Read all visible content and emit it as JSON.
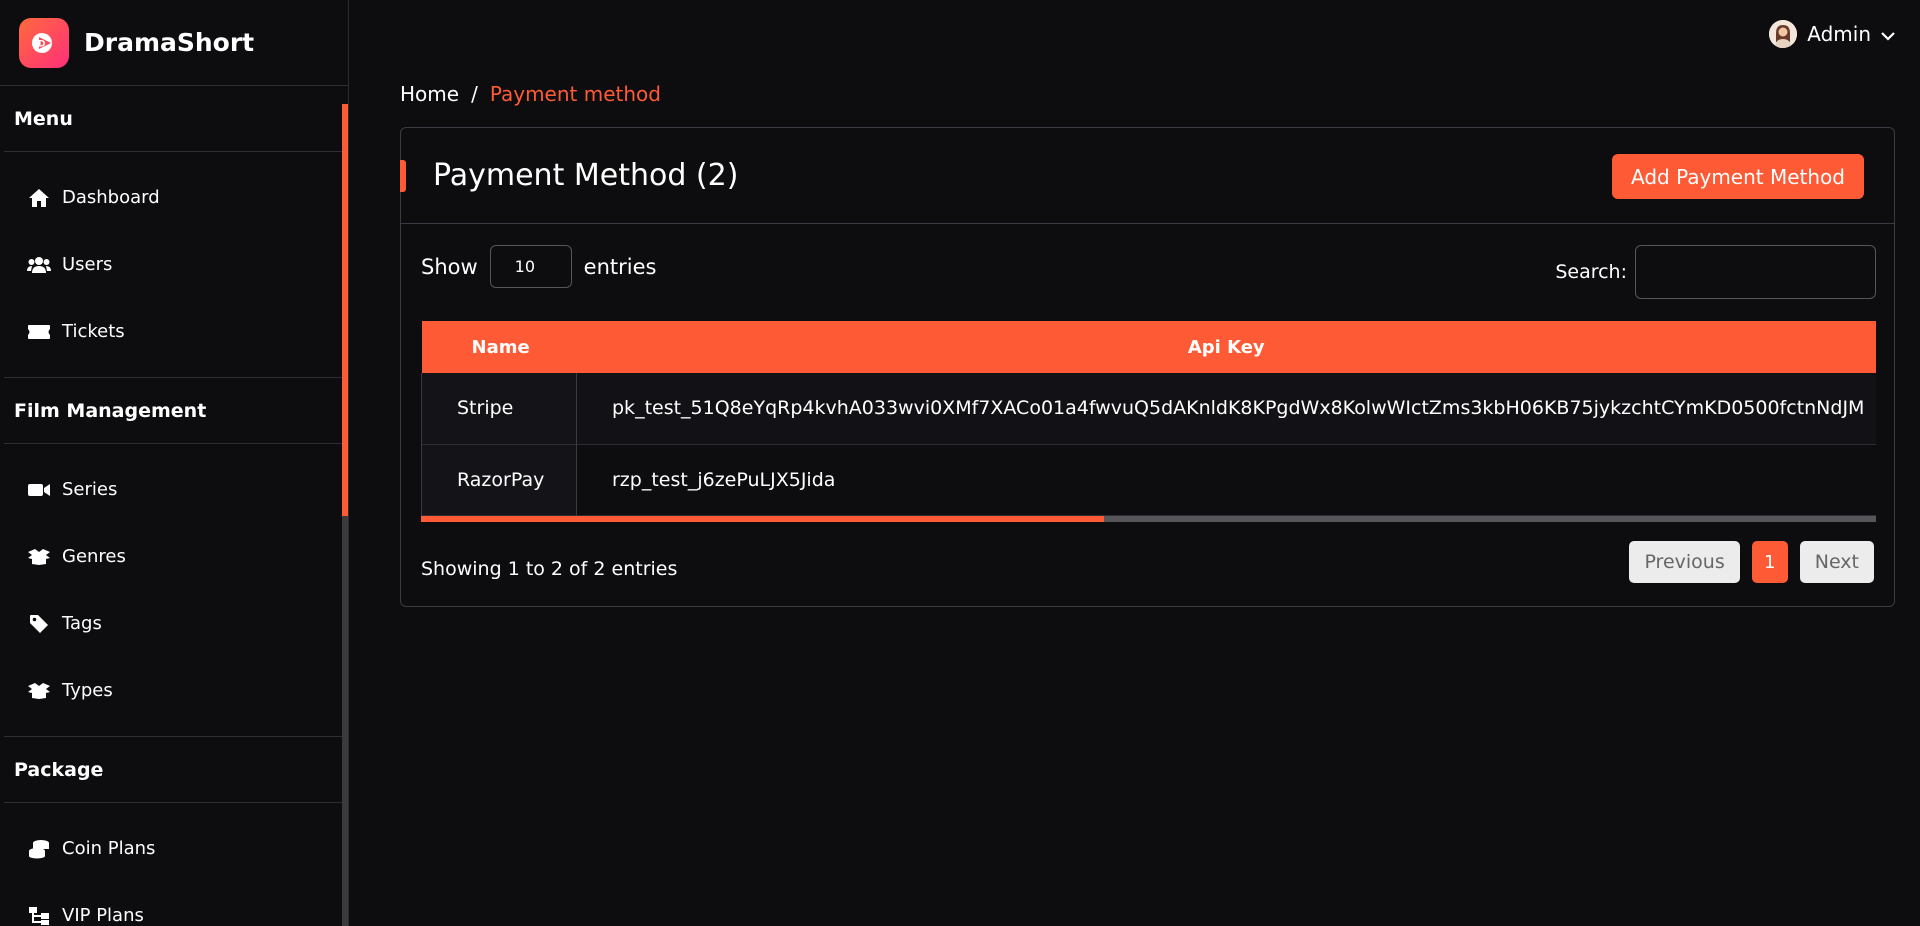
{
  "brand": {
    "name": "DramaShort",
    "logo_icon": "play-icon"
  },
  "user": {
    "name": "Admin"
  },
  "sidebar": {
    "sections": [
      {
        "title": "Menu",
        "items": [
          {
            "label": "Dashboard",
            "icon": "home-icon"
          },
          {
            "label": "Users",
            "icon": "users-icon"
          },
          {
            "label": "Tickets",
            "icon": "ticket-icon"
          }
        ]
      },
      {
        "title": "Film Management",
        "items": [
          {
            "label": "Series",
            "icon": "video-icon"
          },
          {
            "label": "Genres",
            "icon": "box-icon"
          },
          {
            "label": "Tags",
            "icon": "tag-icon"
          },
          {
            "label": "Types",
            "icon": "box-icon"
          }
        ]
      },
      {
        "title": "Package",
        "items": [
          {
            "label": "Coin Plans",
            "icon": "coins-icon"
          },
          {
            "label": "VIP Plans",
            "icon": "network-icon"
          }
        ]
      }
    ]
  },
  "breadcrumb": {
    "home": "Home",
    "separator": "/",
    "current": "Payment method"
  },
  "card": {
    "title": "Payment Method (2)",
    "add_label": "Add Payment Method"
  },
  "controls": {
    "show_label": "Show",
    "page_size": "10",
    "entries_label": "entries",
    "search_label": "Search:"
  },
  "table": {
    "headers": {
      "name": "Name",
      "key": "Api Key"
    },
    "rows": [
      {
        "name": "Stripe",
        "key": "pk_test_51Q8eYqRp4kvhA033wvi0XMf7XACo01a4fwvuQ5dAKnldK8KPgdWx8KolwWIctZms3kbH06KB75jykzchtCYmKD0500fctnNdJM"
      },
      {
        "name": "RazorPay",
        "key": "rzp_test_j6zePuLJX5Jida"
      }
    ]
  },
  "footer": {
    "info": "Showing 1 to 2 of 2 entries",
    "prev": "Previous",
    "page": "1",
    "next": "Next"
  },
  "colors": {
    "accent": "#ff5a36",
    "background": "#0d0d10"
  }
}
